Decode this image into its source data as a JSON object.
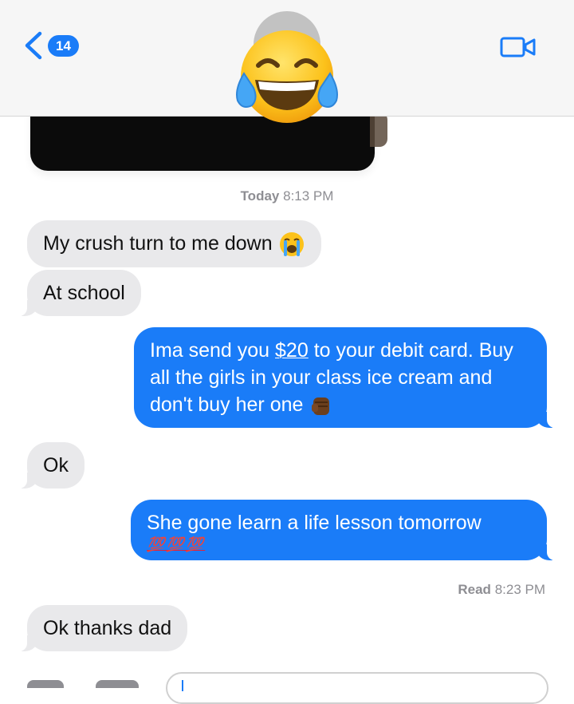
{
  "header": {
    "back_count": "14",
    "icons": {
      "back": "chevron-left-icon",
      "video": "video-camera-icon",
      "overlay": "tears-of-joy-emoji"
    }
  },
  "conversation": {
    "timestamp_day": "Today",
    "timestamp_time": "8:13 PM",
    "messages": [
      {
        "from": "them",
        "text": "My crush turn to me down",
        "emoji": "loudly-crying-face-emoji"
      },
      {
        "from": "them",
        "text": "At school"
      },
      {
        "from": "me",
        "text_before": "Ima send you ",
        "link": "$20",
        "text_after": " to your debit card. Buy all the girls in your class ice cream and don't buy her one",
        "emoji": "raised-fist-emoji"
      },
      {
        "from": "them",
        "text": "Ok"
      },
      {
        "from": "me",
        "text": "She gone learn a life lesson tomorrow",
        "emoji_text": "💯💯💯"
      },
      {
        "from": "them",
        "text": "Ok thanks dad"
      }
    ],
    "read_label": "Read",
    "read_time": "8:23 PM"
  },
  "colors": {
    "outgoing": "#1a7cf8",
    "incoming": "#e9e9eb",
    "meta_text": "#8e8e93"
  }
}
